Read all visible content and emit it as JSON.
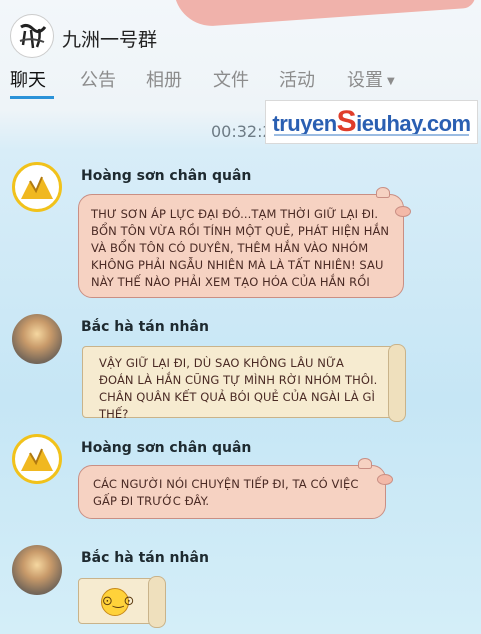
{
  "header": {
    "group_name": "九洲一号群"
  },
  "tabs": [
    {
      "label": "聊天",
      "active": true
    },
    {
      "label": "公告"
    },
    {
      "label": "相册"
    },
    {
      "label": "文件"
    },
    {
      "label": "活动"
    },
    {
      "label": "设置"
    }
  ],
  "timestamp": "00:32:2",
  "watermark": {
    "part1": "truyen",
    "part2": "S",
    "part3": "ieuhay.com"
  },
  "messages": [
    {
      "sender": "Hoàng sơn chân quân",
      "text": "Thư sơn áp lực đại đó...tạm thời giữ lại đi. Bổn tôn vừa rồi tính một quẻ, phát hiện hắn và bổn tôn có duyên, thêm hắn vào nhóm không phải ngẫu nhiên mà là tất nhiên! sau này thế nào phải xem tạo hóa của hắn rồi"
    },
    {
      "sender": "Bắc hà tán nhân",
      "text": "Vậy giữ lại đi, dù sao không lâu nữa đoán là hắn cũng tự mình rời nhóm thôi. chân quân kết quả bói quẻ của ngài là gì thế?"
    },
    {
      "sender": "Hoàng sơn chân quân",
      "text": "Các người nói chuyện tiếp đi, ta có việc gấp đi trước đây."
    },
    {
      "sender": "Bắc hà tán nhân",
      "text": ""
    }
  ],
  "icons": {
    "group_avatar": "calligraphy-avatar-icon",
    "caret": "caret-down-icon",
    "emoji": "surprised-face-icon"
  },
  "colors": {
    "accent": "#2a92d8",
    "pig_bubble": "#f6d2c2",
    "scroll_bubble": "#f6ebd0"
  }
}
